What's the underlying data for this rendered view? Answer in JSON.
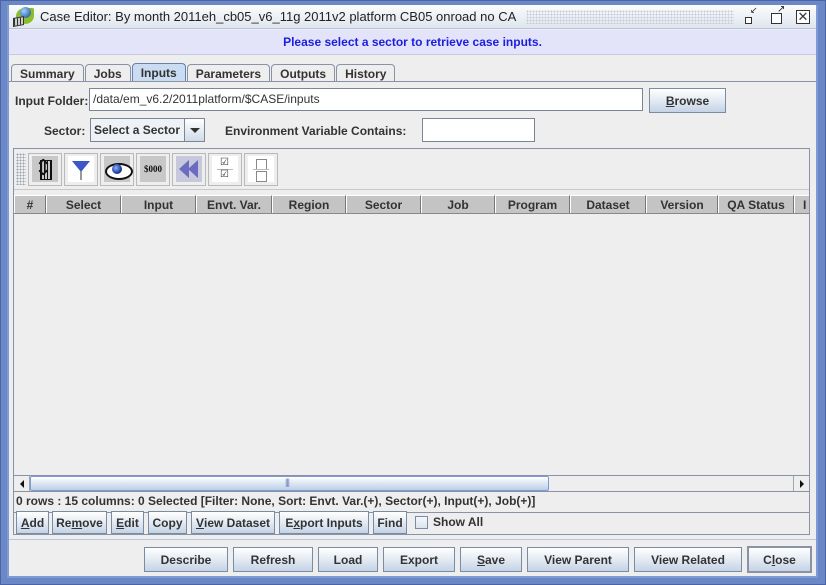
{
  "window": {
    "title": "Case Editor: By month 2011eh_cb05_v6_11g 2011v2 platform CB05 onroad no CA",
    "icon": "emf-globe-icon",
    "controls": [
      "iconify-icon",
      "maximize-icon",
      "close-icon"
    ]
  },
  "message": "Please select a sector to retrieve case inputs.",
  "tabs": [
    {
      "label": "Summary",
      "active": false
    },
    {
      "label": "Jobs",
      "active": false
    },
    {
      "label": "Inputs",
      "active": true
    },
    {
      "label": "Parameters",
      "active": false
    },
    {
      "label": "Outputs",
      "active": false
    },
    {
      "label": "History",
      "active": false
    }
  ],
  "input_folder": {
    "label": "Input Folder:",
    "value": "/data/em_v6.2/2011platform/$CASE/inputs",
    "browse_label": "Browse",
    "browse_mnemonic": "B"
  },
  "sector": {
    "label": "Sector:",
    "selected": "Select a Sector"
  },
  "env_var": {
    "label": "Environment Variable Contains:",
    "value": ""
  },
  "toolbar": {
    "buttons": [
      {
        "name": "sort-icon",
        "tooltip": "Sort"
      },
      {
        "name": "filter-icon",
        "tooltip": "Filter"
      },
      {
        "name": "view-eye-icon",
        "tooltip": "Show/Hide Columns"
      },
      {
        "name": "format-money-icon",
        "tooltip": "Format Columns",
        "text": "$000"
      },
      {
        "name": "reset-rewind-icon",
        "tooltip": "Reset"
      },
      {
        "name": "select-all-icon",
        "tooltip": "Select All"
      },
      {
        "name": "clear-all-icon",
        "tooltip": "Clear All Selections"
      }
    ]
  },
  "table": {
    "columns": [
      "#",
      "Select",
      "Input",
      "Envt. Var.",
      "Region",
      "Sector",
      "Job",
      "Program",
      "Dataset",
      "Version",
      "QA Status",
      "I"
    ],
    "rows": []
  },
  "status": "0 rows : 15 columns: 0 Selected [Filter: None, Sort: Envt. Var.(+), Sector(+), Input(+), Job(+)]",
  "action_buttons": [
    {
      "label": "Add",
      "mnemonic_index": 0
    },
    {
      "label": "Remove",
      "mnemonic_index": 2
    },
    {
      "label": "Edit",
      "mnemonic_index": 0
    },
    {
      "label": "Copy",
      "mnemonic_index": -1
    },
    {
      "label": "View Dataset",
      "mnemonic_index": 0
    },
    {
      "label": "Export Inputs",
      "mnemonic_index": 1
    },
    {
      "label": "Find",
      "mnemonic_index": -1
    }
  ],
  "show_all": {
    "label": "Show All",
    "checked": false
  },
  "footer_buttons": [
    {
      "label": "Describe",
      "mnemonic_index": -1
    },
    {
      "label": "Refresh",
      "mnemonic_index": -1
    },
    {
      "label": "Load",
      "mnemonic_index": -1
    },
    {
      "label": "Export",
      "mnemonic_index": -1
    },
    {
      "label": "Save",
      "mnemonic_index": 0
    },
    {
      "label": "View Parent",
      "mnemonic_index": -1
    },
    {
      "label": "View Related",
      "mnemonic_index": -1
    },
    {
      "label": "Close",
      "mnemonic_index": 1
    }
  ],
  "colors": {
    "message_text": "#1d1de0",
    "message_bg": "#e3e3f9",
    "frame": "#6b87c6",
    "active_tab": "#c9dcf2"
  }
}
